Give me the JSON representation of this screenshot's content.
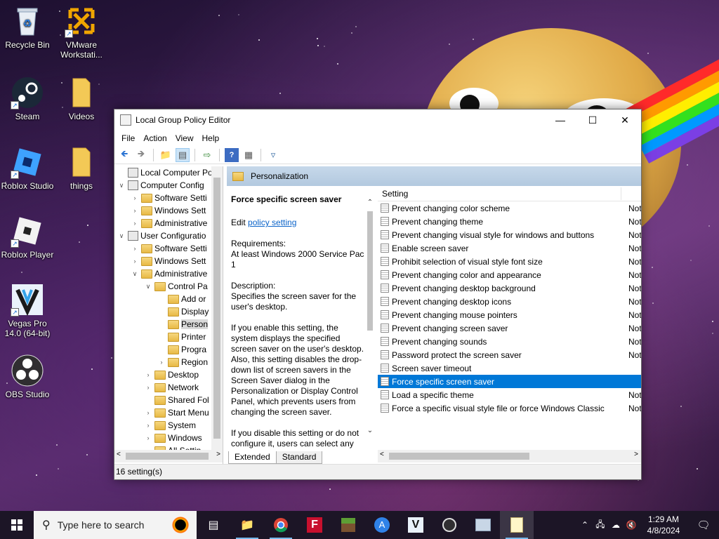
{
  "colors": {
    "accent": "#0078d7",
    "taskbar": "#1c1526",
    "window_header": "#c6d8ea"
  },
  "desktop": {
    "icons": [
      {
        "label": "Recycle Bin",
        "icon": "recycle-bin-icon"
      },
      {
        "label": "VMware Workstati...",
        "icon": "vmware-icon"
      },
      {
        "label": "Steam",
        "icon": "steam-icon"
      },
      {
        "label": "Videos",
        "icon": "folder-icon"
      },
      {
        "label": "Roblox Studio",
        "icon": "roblox-studio-icon"
      },
      {
        "label": "things",
        "icon": "folder-icon"
      },
      {
        "label": "Roblox Player",
        "icon": "roblox-player-icon"
      },
      {
        "label": "Vegas Pro 14.0 (64-bit)",
        "icon": "vegas-pro-icon"
      },
      {
        "label": "OBS Studio",
        "icon": "obs-icon"
      }
    ]
  },
  "window": {
    "title": "Local Group Policy Editor",
    "menu": [
      "File",
      "Action",
      "View",
      "Help"
    ],
    "toolbar": [
      "back-icon",
      "forward-icon",
      "up-folder-icon",
      "show-hide-tree-icon",
      "export-icon",
      "help-icon",
      "properties-icon",
      "filter-icon"
    ]
  },
  "tree": [
    {
      "label": "Local Computer Polic",
      "depth": 0,
      "exp": "",
      "icon": "policy"
    },
    {
      "label": "Computer Config",
      "depth": 0,
      "exp": "v",
      "icon": "computer"
    },
    {
      "label": "Software Setti",
      "depth": 1,
      "exp": ">",
      "icon": "folder"
    },
    {
      "label": "Windows Sett",
      "depth": 1,
      "exp": ">",
      "icon": "folder"
    },
    {
      "label": "Administrative",
      "depth": 1,
      "exp": ">",
      "icon": "folder"
    },
    {
      "label": "User Configuratio",
      "depth": 0,
      "exp": "v",
      "icon": "user"
    },
    {
      "label": "Software Setti",
      "depth": 1,
      "exp": ">",
      "icon": "folder"
    },
    {
      "label": "Windows Sett",
      "depth": 1,
      "exp": ">",
      "icon": "folder"
    },
    {
      "label": "Administrative",
      "depth": 1,
      "exp": "v",
      "icon": "folder"
    },
    {
      "label": "Control Pa",
      "depth": 2,
      "exp": "v",
      "icon": "folder"
    },
    {
      "label": "Add or",
      "depth": 3,
      "exp": "",
      "icon": "folder"
    },
    {
      "label": "Display",
      "depth": 3,
      "exp": "",
      "icon": "folder"
    },
    {
      "label": "Person",
      "depth": 3,
      "exp": "",
      "icon": "folder",
      "selected": true
    },
    {
      "label": "Printer",
      "depth": 3,
      "exp": "",
      "icon": "folder"
    },
    {
      "label": "Progra",
      "depth": 3,
      "exp": "",
      "icon": "folder"
    },
    {
      "label": "Region",
      "depth": 3,
      "exp": ">",
      "icon": "folder"
    },
    {
      "label": "Desktop",
      "depth": 2,
      "exp": ">",
      "icon": "folder"
    },
    {
      "label": "Network",
      "depth": 2,
      "exp": ">",
      "icon": "folder"
    },
    {
      "label": "Shared Fol",
      "depth": 2,
      "exp": "",
      "icon": "folder"
    },
    {
      "label": "Start Menu",
      "depth": 2,
      "exp": ">",
      "icon": "folder"
    },
    {
      "label": "System",
      "depth": 2,
      "exp": ">",
      "icon": "folder"
    },
    {
      "label": "Windows",
      "depth": 2,
      "exp": ">",
      "icon": "folder"
    },
    {
      "label": "All Settin",
      "depth": 2,
      "exp": "",
      "icon": "folder"
    }
  ],
  "pane": {
    "header": "Personalization",
    "desc_title": "Force specific screen saver",
    "edit_prefix": "Edit ",
    "edit_link": "policy setting",
    "requirements": "Requirements:\nAt least Windows 2000 Service Pack 1",
    "description": "Description:\nSpecifies the screen saver for the user's desktop.",
    "enable_text": "If you enable this setting, the system displays the specified screen saver on the user's desktop. Also, this setting disables the drop-down list of screen savers in the Screen Saver dialog in the Personalization or Display Control Panel, which prevents users from changing the screen saver.",
    "disable_text": "If you disable this setting or do not configure it, users can select any screen saver."
  },
  "list": {
    "column_setting": "Setting",
    "rows": [
      {
        "name": "Prevent changing color scheme",
        "state": "Not"
      },
      {
        "name": "Prevent changing theme",
        "state": "Not"
      },
      {
        "name": "Prevent changing visual style for windows and buttons",
        "state": "Not"
      },
      {
        "name": "Enable screen saver",
        "state": "Not"
      },
      {
        "name": "Prohibit selection of visual style font size",
        "state": "Not"
      },
      {
        "name": "Prevent changing color and appearance",
        "state": "Not"
      },
      {
        "name": "Prevent changing desktop background",
        "state": "Not"
      },
      {
        "name": "Prevent changing desktop icons",
        "state": "Not"
      },
      {
        "name": "Prevent changing mouse pointers",
        "state": "Not"
      },
      {
        "name": "Prevent changing screen saver",
        "state": "Not"
      },
      {
        "name": "Prevent changing sounds",
        "state": "Not"
      },
      {
        "name": "Password protect the screen saver",
        "state": "Not"
      },
      {
        "name": "Screen saver timeout",
        "state": ""
      },
      {
        "name": "Force specific screen saver",
        "state": "",
        "selected": true
      },
      {
        "name": "Load a specific theme",
        "state": "Not"
      },
      {
        "name": "Force a specific visual style file or force Windows Classic",
        "state": "Not"
      }
    ]
  },
  "tabs": [
    "Extended",
    "Standard"
  ],
  "status": "16 setting(s)",
  "taskbar": {
    "search_placeholder": "Type here to search",
    "apps": [
      "task-view-icon",
      "file-explorer-icon",
      "chrome-icon",
      "f-app-icon",
      "minecraft-icon",
      "app-store-icon",
      "vegas-icon",
      "obs-icon",
      "control-panel-icon",
      "policy-editor-icon"
    ],
    "time": "1:29 AM",
    "date": "4/8/2024"
  }
}
